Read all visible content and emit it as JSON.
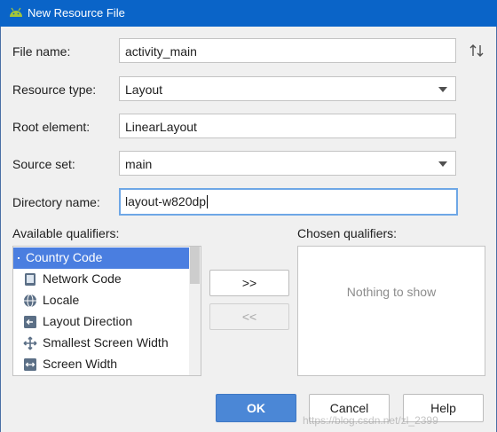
{
  "window": {
    "title": "New Resource File",
    "app_icon": "android-icon"
  },
  "form": {
    "file_name": {
      "label": "File name:",
      "value": "activity_main"
    },
    "resource_type": {
      "label": "Resource type:",
      "value": "Layout"
    },
    "root_element": {
      "label": "Root element:",
      "value": "LinearLayout"
    },
    "source_set": {
      "label": "Source set:",
      "value": "main"
    },
    "directory_name": {
      "label": "Directory name:",
      "value": "layout-w820dp"
    }
  },
  "available": {
    "label": "Available qualifiers:",
    "items": [
      {
        "label": "Country Code",
        "icon": "country-code-icon",
        "selected": true
      },
      {
        "label": "Network Code",
        "icon": "network-code-icon"
      },
      {
        "label": "Locale",
        "icon": "globe-icon"
      },
      {
        "label": "Layout Direction",
        "icon": "layout-direction-icon"
      },
      {
        "label": "Smallest Screen Width",
        "icon": "smallest-width-icon"
      },
      {
        "label": "Screen Width",
        "icon": "screen-width-icon"
      }
    ]
  },
  "transfer": {
    "add_label": ">>",
    "remove_label": "<<"
  },
  "chosen": {
    "label": "Chosen qualifiers:",
    "empty_text": "Nothing to show"
  },
  "buttons": {
    "ok": "OK",
    "cancel": "Cancel",
    "help": "Help"
  },
  "watermark": "https://blog.csdn.net/zl_2399",
  "colors": {
    "title_bar": "#0a64c8",
    "selection": "#4a7ee0",
    "ok_button": "#4b87d6",
    "focus_border": "#6ea7e6"
  }
}
